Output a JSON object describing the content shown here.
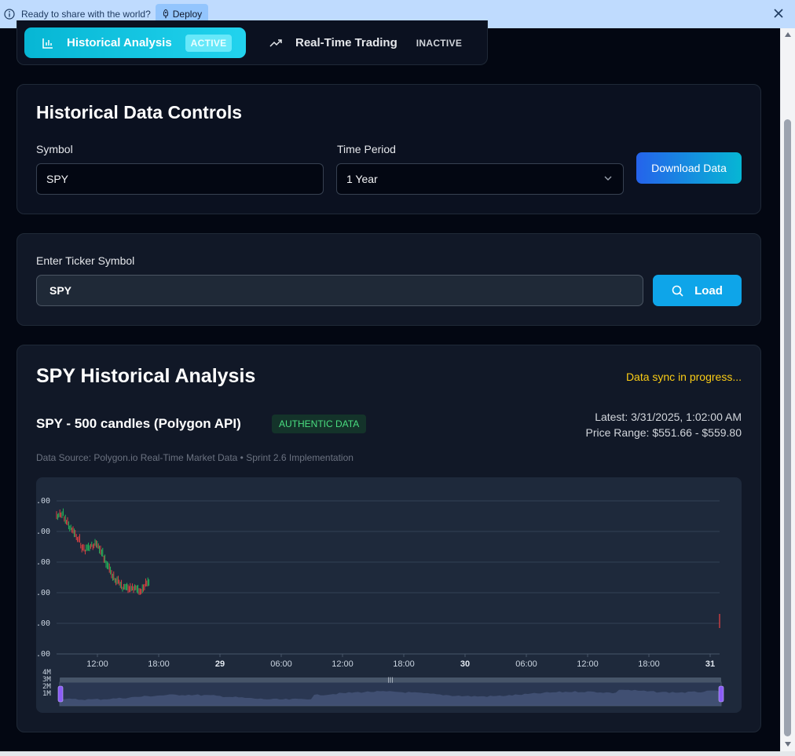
{
  "banner": {
    "text": "Ready to share with the world?",
    "deploy_label": "Deploy"
  },
  "tabs": [
    {
      "label": "Historical Analysis",
      "badge": "ACTIVE"
    },
    {
      "label": "Real-Time Trading",
      "badge": "INACTIVE"
    }
  ],
  "controls": {
    "title": "Historical Data Controls",
    "symbol_label": "Symbol",
    "symbol_value": "SPY",
    "period_label": "Time Period",
    "period_value": "1 Year",
    "download_label": "Download Data"
  },
  "ticker": {
    "label": "Enter Ticker Symbol",
    "value": "SPY",
    "load_label": "Load"
  },
  "analysis": {
    "title": "SPY Historical Analysis",
    "sync_status": "Data sync in progress...",
    "subtitle": "SPY - 500 candles (Polygon API)",
    "badge": "AUTHENTIC DATA",
    "latest": "Latest: 3/31/2025, 1:02:00 AM",
    "price_range": "Price Range: $551.66 - $559.80",
    "source": "Data Source: Polygon.io Real-Time Market Data • Sprint 2.6 Implementation"
  },
  "colors": {
    "accent": "#06b6d4",
    "up": "#22c55e",
    "down": "#ef4444",
    "warning": "#facc15",
    "scrollbar_handle": "#8b5cf6"
  },
  "chart_data": {
    "type": "candlestick",
    "y_tick_labels": [
      ".00",
      ".00",
      ".00",
      ".00",
      ".00",
      ".00"
    ],
    "x_tick_labels": [
      {
        "label": "12:00",
        "bold": false
      },
      {
        "label": "18:00",
        "bold": false
      },
      {
        "label": "29",
        "bold": true
      },
      {
        "label": "06:00",
        "bold": false
      },
      {
        "label": "12:00",
        "bold": false
      },
      {
        "label": "18:00",
        "bold": false
      },
      {
        "label": "30",
        "bold": true
      },
      {
        "label": "06:00",
        "bold": false
      },
      {
        "label": "12:00",
        "bold": false
      },
      {
        "label": "18:00",
        "bold": false
      },
      {
        "label": "31",
        "bold": true
      }
    ],
    "volume_tick_labels": [
      "4M",
      "3M",
      "2M",
      "1M"
    ],
    "grid": true
  }
}
